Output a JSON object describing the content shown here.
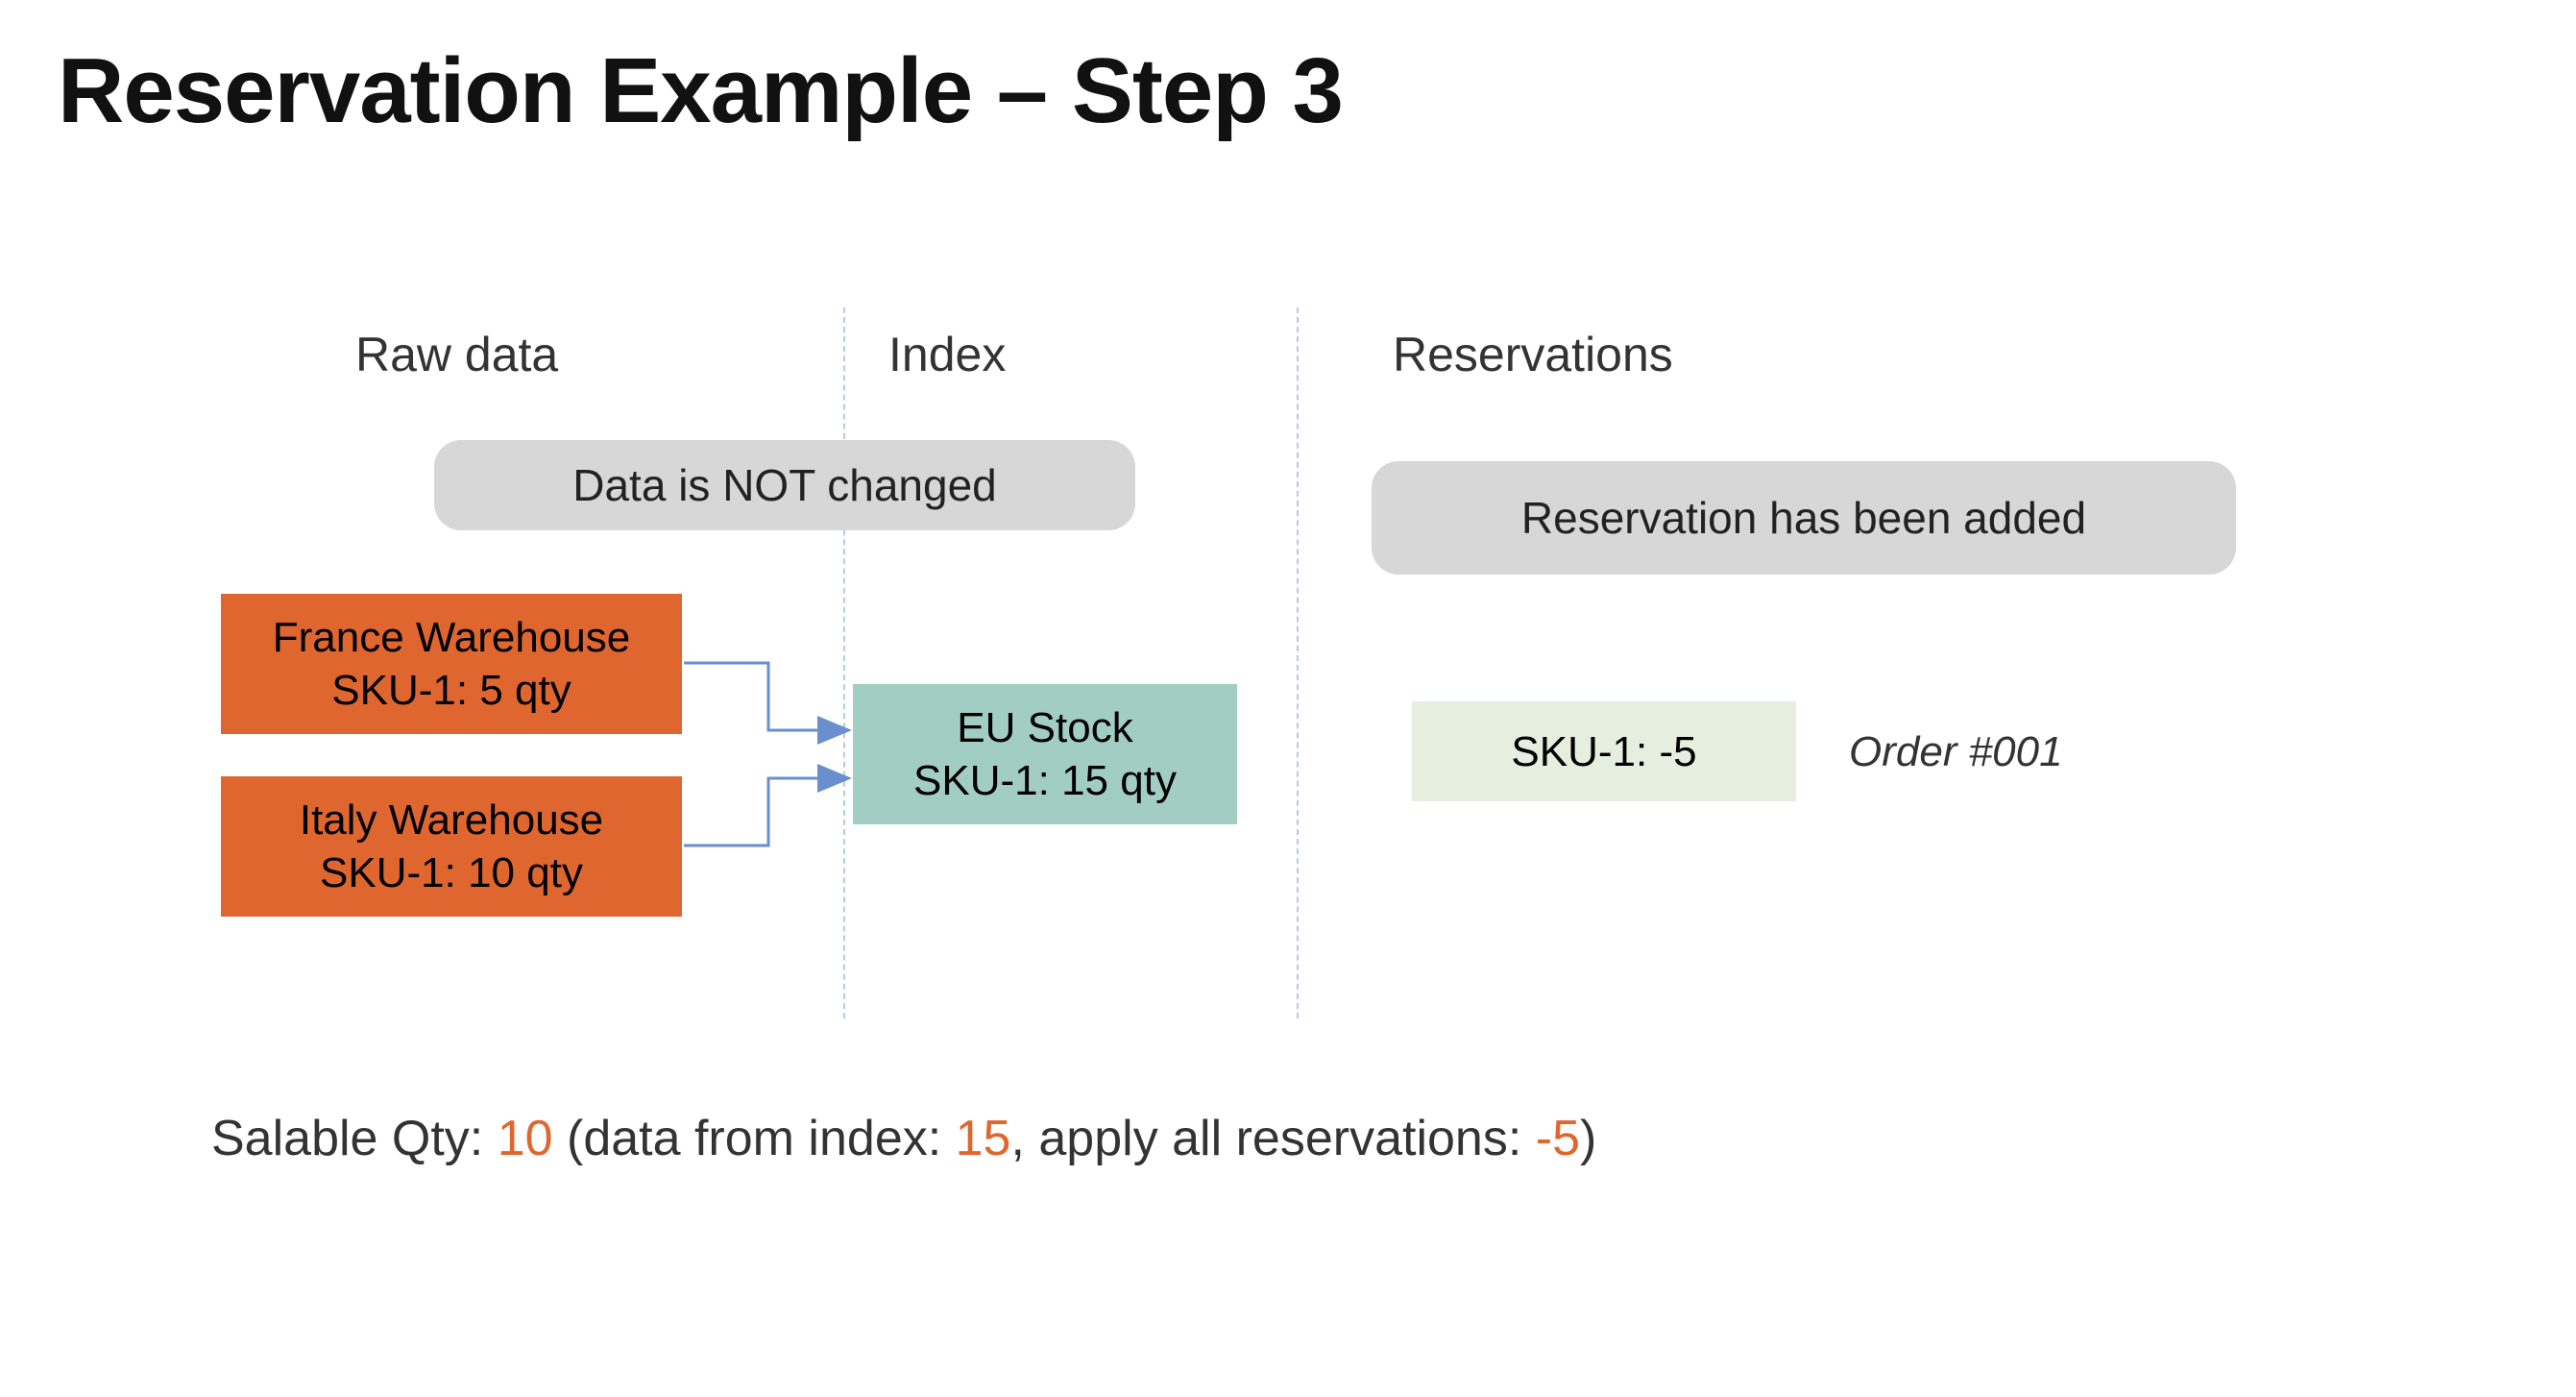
{
  "title": "Reservation Example – Step 3",
  "columns": {
    "raw": "Raw data",
    "index": "Index",
    "reservations": "Reservations"
  },
  "notes": {
    "data_unchanged": "Data is NOT changed",
    "reservation_added": "Reservation has been added"
  },
  "warehouses": {
    "france": {
      "name": "France Warehouse",
      "line": "SKU-1: 5 qty"
    },
    "italy": {
      "name": "Italy Warehouse",
      "line": "SKU-1: 10 qty"
    }
  },
  "index_box": {
    "name": "EU Stock",
    "line": "SKU-1: 15 qty"
  },
  "reservation_box": {
    "line": "SKU-1: -5",
    "order": "Order #001"
  },
  "salable": {
    "prefix": "Salable Qty: ",
    "qty": "10",
    "mid1": " (data from index: ",
    "index_val": "15",
    "mid2": ", apply all reservations: ",
    "resv_val": "-5",
    "suffix": ")"
  },
  "colors": {
    "orange": "#e0662f",
    "teal": "#a2cdc2",
    "pale": "#e5eedf",
    "grey": "#d7d7d7",
    "dash": "#b7c9e6",
    "connector": "#6a8fcf"
  }
}
